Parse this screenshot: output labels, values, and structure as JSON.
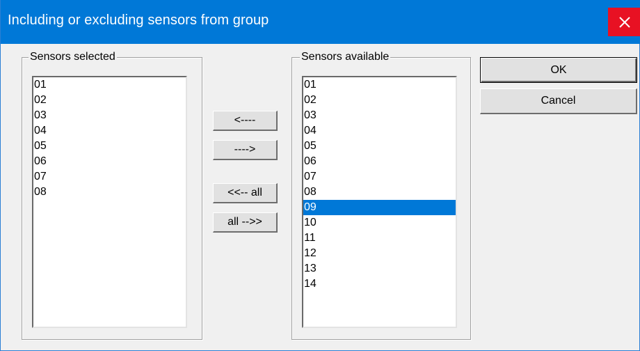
{
  "window": {
    "title": "Including or excluding sensors from group"
  },
  "icons": {
    "close": "close-icon"
  },
  "selected_group": {
    "label": "Sensors selected",
    "items": [
      "01",
      "02",
      "03",
      "04",
      "05",
      "06",
      "07",
      "08"
    ]
  },
  "available_group": {
    "label": "Sensors available",
    "items": [
      "01",
      "02",
      "03",
      "04",
      "05",
      "06",
      "07",
      "08",
      "09",
      "10",
      "11",
      "12",
      "13",
      "14"
    ],
    "selected_item": "09"
  },
  "buttons": {
    "move_left": "<----",
    "move_right": "---->",
    "move_all_left": "<<-- all",
    "move_all_right": "all -->>",
    "ok": "OK",
    "cancel": "Cancel"
  },
  "colors": {
    "title_bar": "#0078d7",
    "close_button": "#e81123",
    "selection": "#0078d7"
  }
}
